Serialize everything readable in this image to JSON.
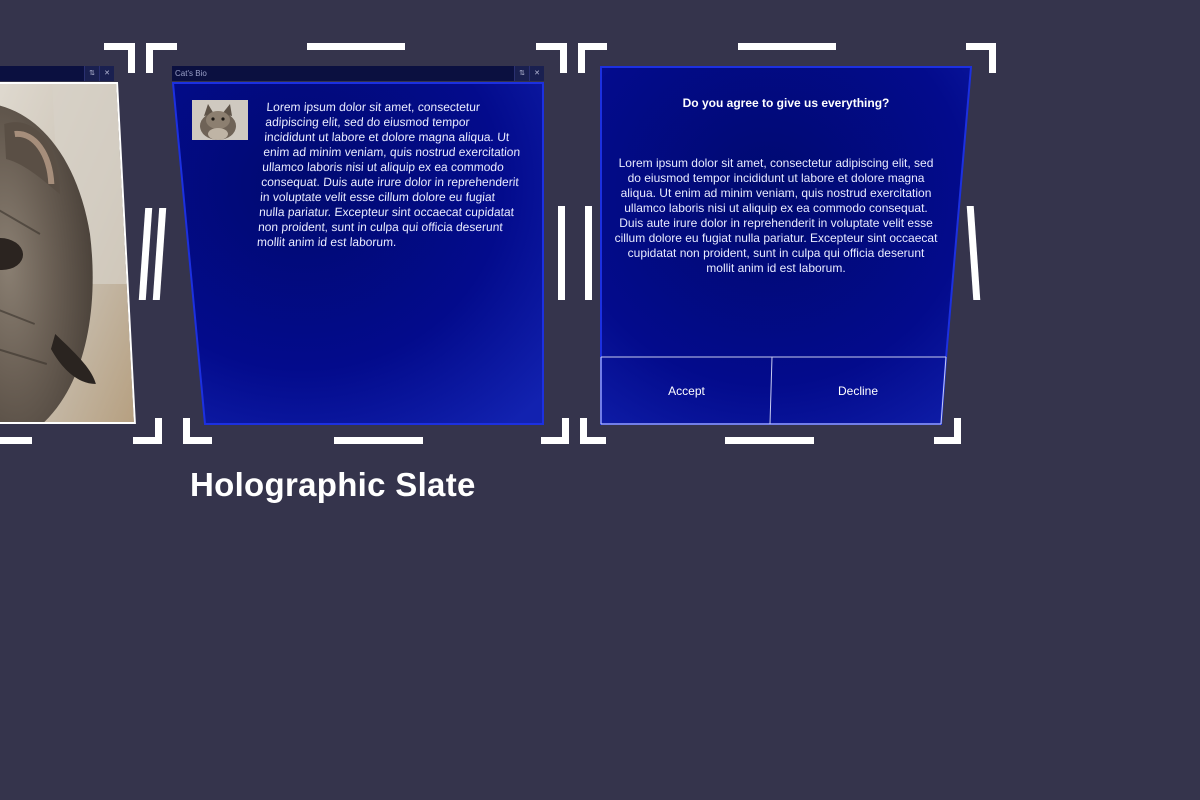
{
  "slates": {
    "photo": {
      "title": ""
    },
    "bio": {
      "title": "Cat's Bio",
      "follow_glyph": "⇅",
      "close_glyph": "✕",
      "text": "Lorem ipsum dolor sit amet, consectetur adipiscing elit, sed do eiusmod tempor incididunt ut labore et dolore magna aliqua. Ut enim ad minim veniam, quis nostrud exercitation ullamco laboris nisi ut aliquip ex ea commodo consequat. Duis aute irure dolor in reprehenderit in voluptate velit esse cillum dolore eu fugiat nulla pariatur. Excepteur sint occaecat cupidatat non proident, sunt in culpa qui officia deserunt mollit anim id est laborum."
    },
    "dialog": {
      "title": "Do you agree to give us everything?",
      "text": "Lorem ipsum dolor sit amet, consectetur adipiscing elit, sed do eiusmod tempor incididunt ut labore et dolore magna aliqua. Ut enim ad minim veniam, quis nostrud exercitation ullamco laboris nisi ut aliquip ex ea commodo consequat. Duis aute irure dolor in reprehenderit in voluptate velit esse cillum dolore eu fugiat nulla pariatur. Excepteur sint occaecat cupidatat non proident, sunt in culpa qui officia deserunt mollit anim id est laborum.",
      "accept_label": "Accept",
      "decline_label": "Decline"
    }
  },
  "heading": "Holographic Slate",
  "colors": {
    "background": "#35344c",
    "panel": "#030a8a",
    "panel_border": "#1c2fd4",
    "titlebar": "#0b1040",
    "handles": "#ffffff"
  },
  "icons": {
    "follow": "follow-me-icon",
    "close": "close-icon"
  }
}
